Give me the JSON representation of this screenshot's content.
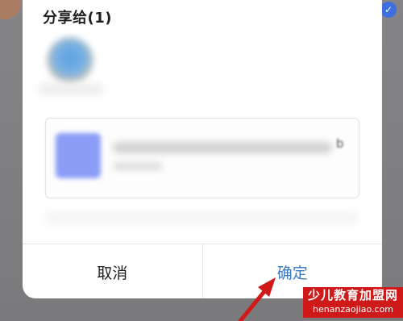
{
  "dialog": {
    "title": "分享给(1)",
    "file_card": {
      "name_tail": "b"
    },
    "buttons": {
      "cancel": "取消",
      "confirm": "确定"
    }
  },
  "background": {
    "check_icon": "✓"
  },
  "watermark": {
    "title": "少儿教育加盟网",
    "url": "henanzaojiao.com"
  },
  "colors": {
    "accent": "#3a78c8",
    "arrow": "#d01a1a",
    "watermark_bg": "#d01a1a",
    "overlay": "#7e7e80"
  }
}
